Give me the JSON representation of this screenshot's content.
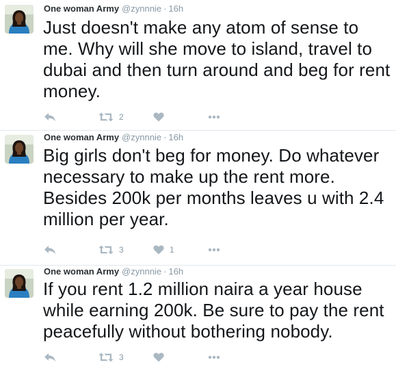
{
  "tweets": [
    {
      "name": "One woman Army",
      "handle": "@zynnnie",
      "separator": "·",
      "time": "16h",
      "text": "Just doesn't make any atom of sense to me. Why will she move to island, travel to dubai and then turn around and beg for rent money.",
      "retweets": "2",
      "likes": ""
    },
    {
      "name": "One woman Army",
      "handle": "@zynnnie",
      "separator": "·",
      "time": "16h",
      "text": "Big girls don't beg for money. Do whatever necessary to make up the rent more. Besides 200k per months leaves u with 2.4 million per year.",
      "retweets": "3",
      "likes": "1"
    },
    {
      "name": "One woman Army",
      "handle": "@zynnnie",
      "separator": "·",
      "time": "16h",
      "text": "If you rent 1.2 million naira a year house while earning 200k. Be sure to pay the rent peacefully without bothering nobody.",
      "retweets": "3",
      "likes": ""
    }
  ],
  "icons": {
    "reply": "reply-icon",
    "retweet": "retweet-icon",
    "like": "heart-icon",
    "more": "more-icon"
  },
  "colors": {
    "icon": "#aab8c2",
    "meta": "#8899a6",
    "text": "#14171a",
    "divider": "#e1e8ed"
  }
}
